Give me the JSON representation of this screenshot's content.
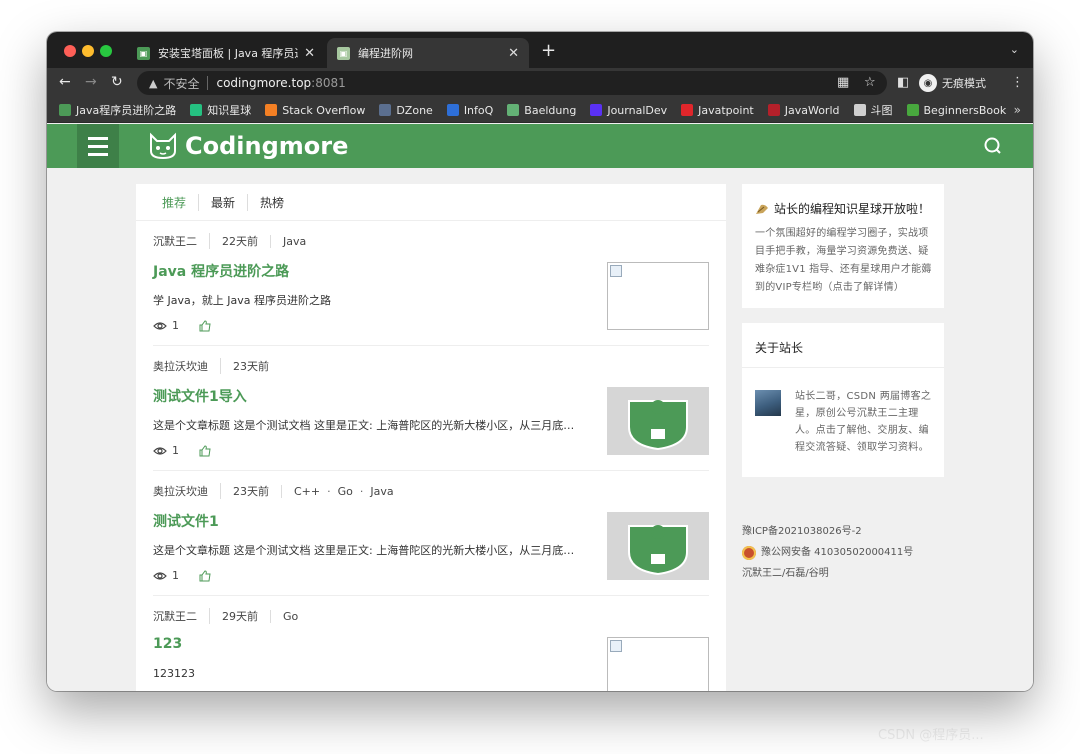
{
  "browser": {
    "tabs": [
      {
        "title": "安装宝塔面板 | Java 程序员进阶",
        "close": "✕"
      },
      {
        "title": "编程进阶网",
        "close": "✕"
      }
    ],
    "new_tab": "+",
    "address": {
      "security_label": "不安全",
      "host": "codingmore.top",
      "port": ":8081"
    },
    "incognito_label": "无痕模式",
    "bookmarks": [
      {
        "label": "Java程序员进阶之路",
        "icon": "site-icon",
        "color": "#4c9a57"
      },
      {
        "label": "知识星球",
        "icon": "planet-icon",
        "color": "#25c181"
      },
      {
        "label": "Stack Overflow",
        "icon": "stackoverflow-icon",
        "color": "#f48024"
      },
      {
        "label": "DZone",
        "icon": "dzone-icon",
        "color": "#5b6f8f"
      },
      {
        "label": "InfoQ",
        "icon": "infoq-icon",
        "color": "#2e6fd8"
      },
      {
        "label": "Baeldung",
        "icon": "baeldung-icon",
        "color": "#63b175"
      },
      {
        "label": "JournalDev",
        "icon": "journaldev-icon",
        "color": "#5a31f4"
      },
      {
        "label": "Javatpoint",
        "icon": "javatpoint-icon",
        "color": "#e0262b"
      },
      {
        "label": "JavaWorld",
        "icon": "javaworld-icon",
        "color": "#b4202a"
      },
      {
        "label": "斗图",
        "icon": "folder-icon",
        "color": "#cfcfcf"
      },
      {
        "label": "BeginnersBook",
        "icon": "beginnersbook-icon",
        "color": "#48a83e"
      }
    ],
    "bookmarks_more": "»"
  },
  "site": {
    "brand": "Codingmore",
    "brand_color": "#4c9a57",
    "feed_tabs": [
      "推荐",
      "最新",
      "热榜"
    ],
    "articles": [
      {
        "author": "沉默王二",
        "time": "22天前",
        "tags": [
          "Java"
        ],
        "title": "Java 程序员进阶之路",
        "excerpt": "学 Java，就上 Java 程序员进阶之路",
        "views": "1",
        "thumb": "broken-image"
      },
      {
        "author": "奥拉沃坎迪",
        "time": "23天前",
        "tags": [],
        "title": "测试文件1导入",
        "excerpt": "这是个文章标题 这是个测试文档  这里是正文:   上海普陀区的光新大楼小区，从三月底…",
        "views": "1",
        "thumb": "logo-image"
      },
      {
        "author": "奥拉沃坎迪",
        "time": "23天前",
        "tags": [
          "C++",
          "Go",
          "Java"
        ],
        "title": "测试文件1",
        "excerpt": "这是个文章标题 这是个测试文档  这里是正文:   上海普陀区的光新大楼小区，从三月底…",
        "views": "1",
        "thumb": "logo-image"
      },
      {
        "author": "沉默王二",
        "time": "29天前",
        "tags": [
          "Go"
        ],
        "title": "123",
        "excerpt": "123123",
        "views": "",
        "thumb": "broken-image"
      }
    ],
    "sidebar": {
      "promo_title": "站长的编程知识星球开放啦！",
      "promo_text": "一个氛围超好的编程学习圈子，实战项目手把手教，海量学习资源免费送、疑难杂症1V1 指导、还有星球用户才能薅到的VIP专栏哟（点击了解详情）",
      "about_title": "关于站长",
      "about_text": "站长二哥，CSDN 两届博客之星，原创公号沉默王二主理人。点击了解他、交朋友、编程交流答疑、领取学习资料。",
      "icp": "豫ICP备2021038026号-2",
      "police": "豫公网安备 41030502000411号",
      "credits": "沉默王二/石磊/谷明"
    }
  },
  "watermark": "CSDN @程序员..."
}
